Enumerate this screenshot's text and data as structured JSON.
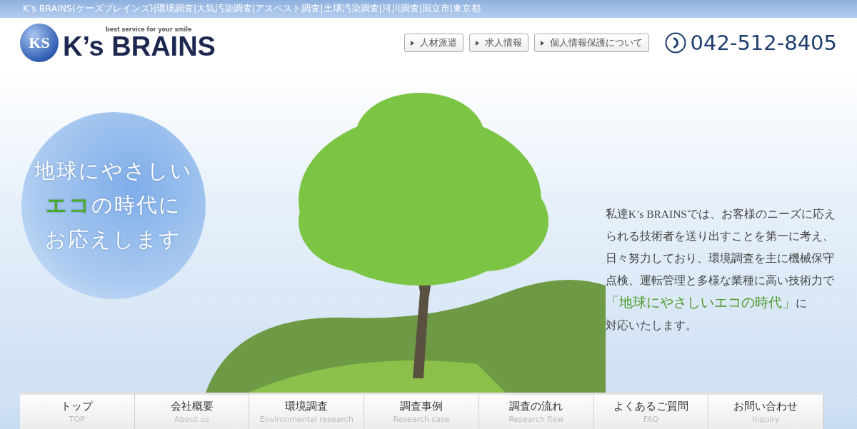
{
  "top_bar": {
    "text": "K’s BRAINS(ケーズブレインズ)|環境調査|大気汚染調査|アスベスト調査|土壌汚染調査|河川調査|国立市|東京都"
  },
  "header": {
    "logo": {
      "mark": "KS",
      "name": "K’s BRAINS",
      "tagline": "best service for your smile"
    },
    "links": [
      "人材派遣",
      "求人情報",
      "個人情報保護について"
    ],
    "phone": "042-512-8405"
  },
  "hero": {
    "circle_lines": [
      "地球にやさしい",
      "**エコ**の時代に",
      "お応えします"
    ],
    "message": [
      "私達K’s BRAINSでは、お客様のニーズに応え",
      "られる技術者を送り出すことを第一に考え、",
      "日々努力しており、環境調査を主に機械保守",
      "点検、運転管理と多様な業種に高い技術力で",
      "**「地球にやさしいエコの時代」**に",
      "対応いたします。"
    ]
  },
  "nav": [
    {
      "label": "トップ",
      "sub": "TOP"
    },
    {
      "label": "会社概要",
      "sub": "About us"
    },
    {
      "label": "環境調査",
      "sub": "Environmental research"
    },
    {
      "label": "調査事例",
      "sub": "Research case"
    },
    {
      "label": "調査の流れ",
      "sub": "Research flow"
    },
    {
      "label": "よくあるご質問",
      "sub": "FAQ"
    },
    {
      "label": "お問い合わせ",
      "sub": "Inquiry"
    }
  ]
}
